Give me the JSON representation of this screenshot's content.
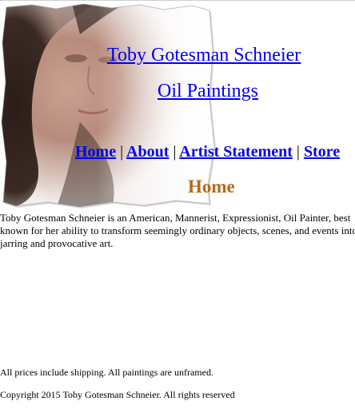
{
  "header": {
    "title": "Toby Gotesman Schneier",
    "subtitle": "Oil Paintings"
  },
  "nav": {
    "items": [
      {
        "label": "Home"
      },
      {
        "label": "About"
      },
      {
        "label": "Artist Statement"
      },
      {
        "label": "Store"
      }
    ],
    "separator": "|"
  },
  "main": {
    "heading": "Home",
    "heading_color": "#b8671a",
    "intro": "Toby Gotesman Schneier is an American, Mannerist, Expressionist, Oil Painter, best known for her ability to transform seemingly ordinary objects, scenes, and events into jarring and provocative art."
  },
  "footer": {
    "prices_note": "All prices include shipping. All paintings are unframed.",
    "copyright": "Copyright 2015 Toby Gotesman Schneier. All rights reserved"
  },
  "colors": {
    "link": "#0000ee"
  }
}
